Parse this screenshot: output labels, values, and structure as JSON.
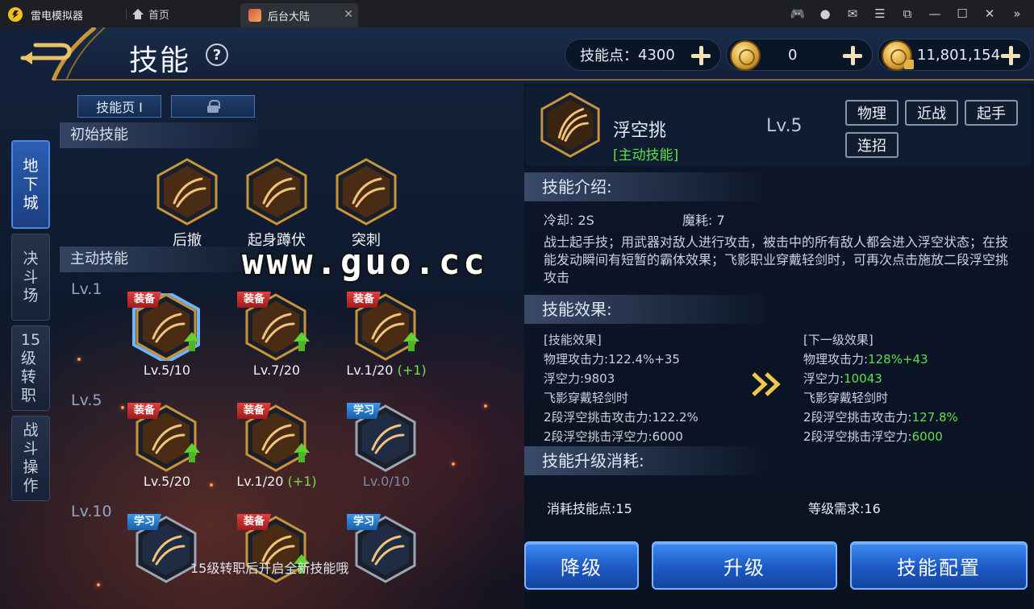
{
  "emulator": {
    "app_name": "雷电模拟器",
    "home_tab": "首页",
    "game_tab": "后台大陆",
    "tools": [
      "gamepad-icon",
      "user-icon",
      "mail-icon",
      "menu-icon",
      "popout-icon",
      "minimize-icon",
      "maximize-icon",
      "close-icon",
      "collapse-icon"
    ]
  },
  "header": {
    "title": "技能",
    "help": "?",
    "skill_points_label": "技能点：",
    "skill_points_value": "4300",
    "coin_value": "0",
    "bound_coin_value": "11,801,154"
  },
  "left": {
    "side_tabs": [
      {
        "label": "地\n下\n城",
        "active": true
      },
      {
        "label": "决\n斗\n场",
        "active": false
      },
      {
        "label": "15\n级\n转\n职",
        "active": false
      },
      {
        "label": "战\n斗\n操\n作",
        "active": false
      }
    ],
    "page_tab_label": "技能页 Ⅰ",
    "initial_section": "初始技能",
    "active_section": "主动技能",
    "initial_skills": [
      {
        "name": "后撤"
      },
      {
        "name": "起身蹲伏"
      },
      {
        "name": "突刺"
      }
    ],
    "level_labels": [
      "Lv.1",
      "Lv.5",
      "Lv.10"
    ],
    "active_skills": [
      {
        "tag": "装备",
        "level": "Lv.5/10",
        "bonus": "",
        "upgrade": true,
        "selected": true
      },
      {
        "tag": "装备",
        "level": "Lv.7/20",
        "bonus": "",
        "upgrade": true,
        "selected": false
      },
      {
        "tag": "装备",
        "level": "Lv.1/20",
        "bonus": "(+1)",
        "upgrade": true,
        "selected": false
      },
      {
        "tag": "装备",
        "level": "Lv.5/20",
        "bonus": "",
        "upgrade": true,
        "selected": false
      },
      {
        "tag": "装备",
        "level": "Lv.1/20",
        "bonus": "(+1)",
        "upgrade": true,
        "selected": false
      },
      {
        "tag": "学习",
        "level": "Lv.0/10",
        "bonus": "",
        "upgrade": false,
        "selected": false
      },
      {
        "tag": "学习",
        "level": "",
        "bonus": "",
        "upgrade": false,
        "selected": false
      },
      {
        "tag": "装备",
        "level": "",
        "bonus": "",
        "upgrade": true,
        "selected": false
      },
      {
        "tag": "学习",
        "level": "",
        "bonus": "",
        "upgrade": false,
        "selected": false
      }
    ],
    "hint": "15级转职后开启全新技能哦"
  },
  "watermark": "www.guo.cc",
  "detail": {
    "name": "浮空挑",
    "type": "[主动技能]",
    "level": "Lv.5",
    "tags": [
      "物理",
      "近战",
      "起手",
      "连招"
    ],
    "intro_head": "技能介绍:",
    "cooldown": "冷却: 2S",
    "mana": "魔耗: 7",
    "description": "战士起手技；用武器对敌人进行攻击，被击中的所有敌人都会进入浮空状态；在技能发动瞬间有短暂的霸体效果；飞影职业穿戴轻剑时，可再次点击施放二段浮空挑攻击",
    "effect_head": "技能效果:",
    "current": {
      "title": "[技能效果]",
      "rows": [
        {
          "label": "物理攻击力:",
          "value": "122.4%+35"
        },
        {
          "label": "浮空力:",
          "value": "9803"
        },
        {
          "label": "飞影穿戴轻剑时",
          "value": ""
        },
        {
          "label": "2段浮空挑击攻击力:",
          "value": "122.2%"
        },
        {
          "label": "2段浮空挑击浮空力:",
          "value": "6000"
        }
      ]
    },
    "next": {
      "title": "[下一级效果]",
      "rows": [
        {
          "label": "物理攻击力:",
          "value": "128%+43"
        },
        {
          "label": "浮空力:",
          "value": "10043"
        },
        {
          "label": "飞影穿戴轻剑时",
          "value": ""
        },
        {
          "label": "2段浮空挑击攻击力:",
          "value": "127.8%"
        },
        {
          "label": "2段浮空挑击浮空力:",
          "value": "6000"
        }
      ]
    },
    "cost_head": "技能升级消耗:",
    "cost_points": "消耗技能点:15",
    "level_req": "等级需求:16",
    "buttons": {
      "downgrade": "降级",
      "upgrade": "升级",
      "config": "技能配置"
    }
  },
  "colors": {
    "green": "#5ce04a",
    "gold": "#c8953a",
    "blue_btn": "#1b58c4"
  }
}
